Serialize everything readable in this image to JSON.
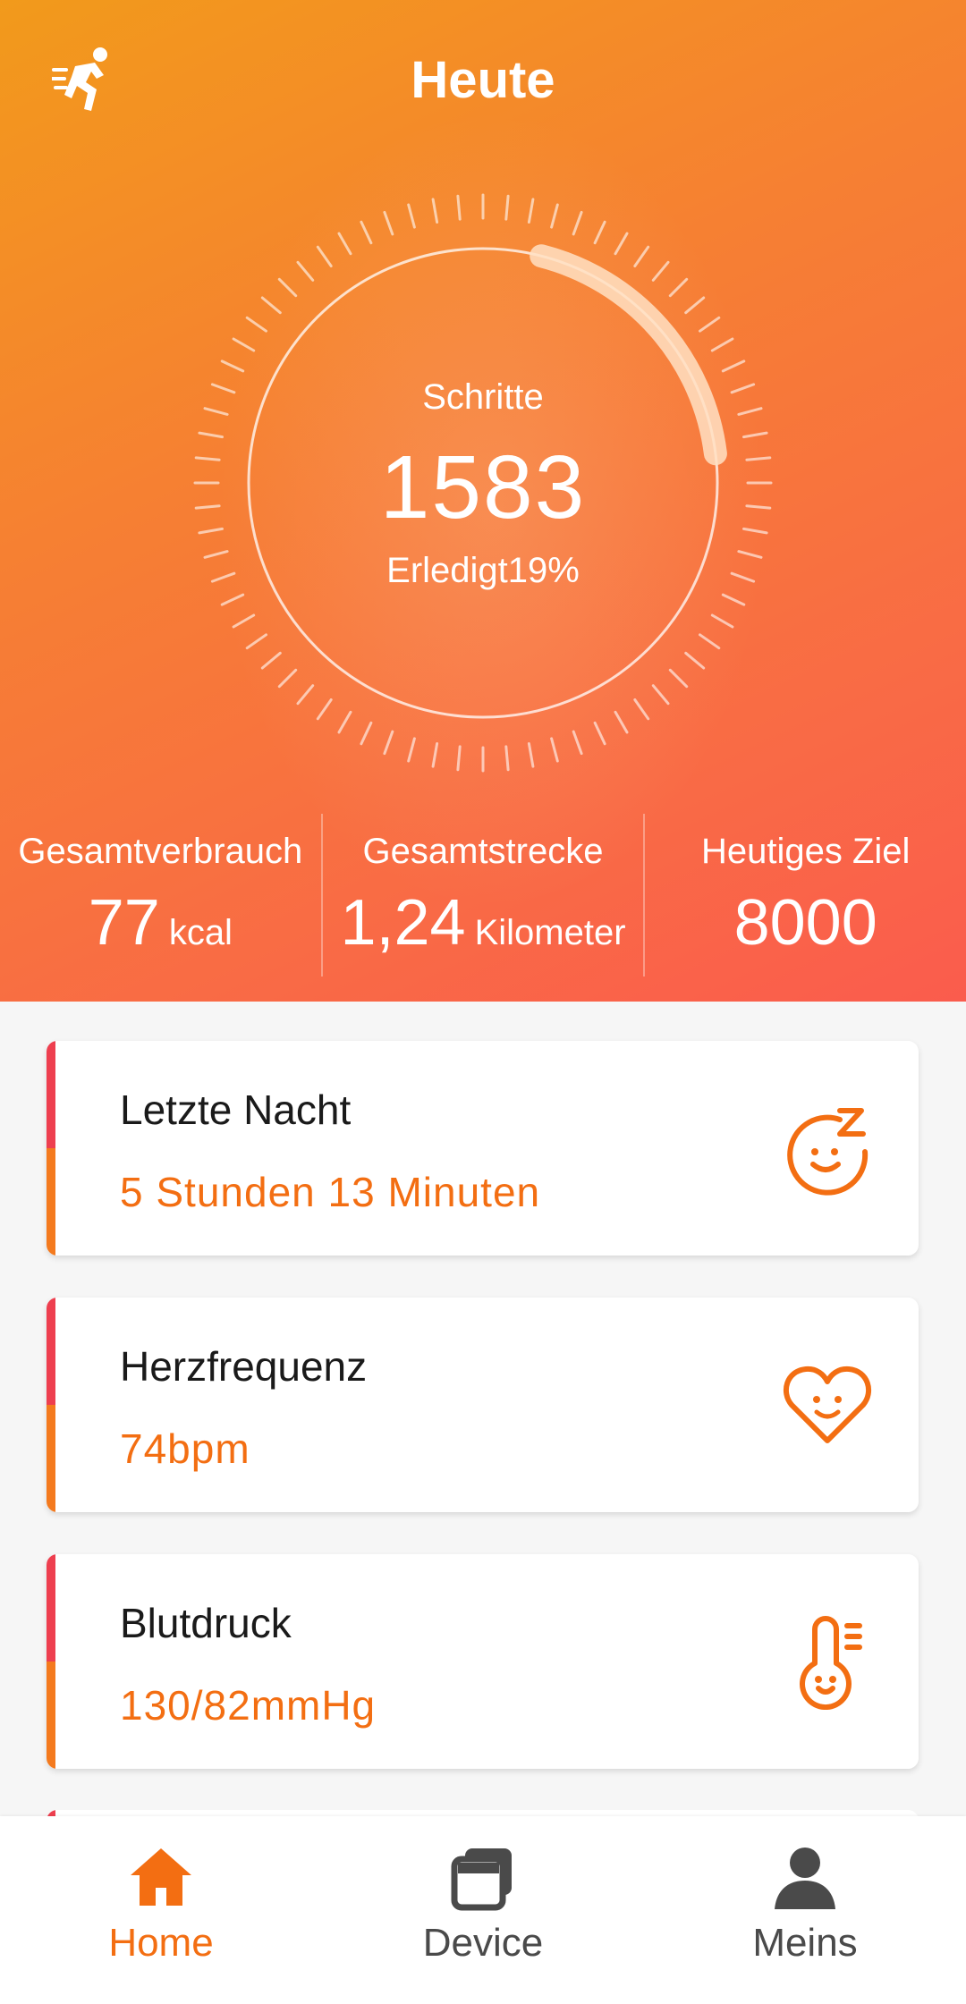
{
  "header": {
    "title": "Heute"
  },
  "steps": {
    "label": "Schritte",
    "value": "1583",
    "completed_text": "Erledigt19%",
    "progress_fraction": 0.19
  },
  "stats": [
    {
      "label": "Gesamtverbrauch",
      "value": "77",
      "unit": "kcal"
    },
    {
      "label": "Gesamtstrecke",
      "value": "1,24",
      "unit": "Kilometer"
    },
    {
      "label": "Heutiges Ziel",
      "value": "8000",
      "unit": ""
    }
  ],
  "cards": [
    {
      "title": "Letzte Nacht",
      "value": "5 Stunden 13 Minuten",
      "icon": "sleep-face-icon"
    },
    {
      "title": "Herzfrequenz",
      "value": "74bpm",
      "icon": "heart-face-icon"
    },
    {
      "title": "Blutdruck",
      "value": "130/82mmHg",
      "icon": "thermometer-face-icon"
    }
  ],
  "tabs": [
    {
      "label": "Home",
      "icon": "home-icon",
      "active": true
    },
    {
      "label": "Device",
      "icon": "device-icon",
      "active": false
    },
    {
      "label": "Meins",
      "icon": "person-icon",
      "active": false
    }
  ],
  "colors": {
    "accent": "#f36e12",
    "accent_red": "#ee3f4f",
    "hero_top": "#f29a1b",
    "hero_bottom": "#fa5c4d"
  }
}
